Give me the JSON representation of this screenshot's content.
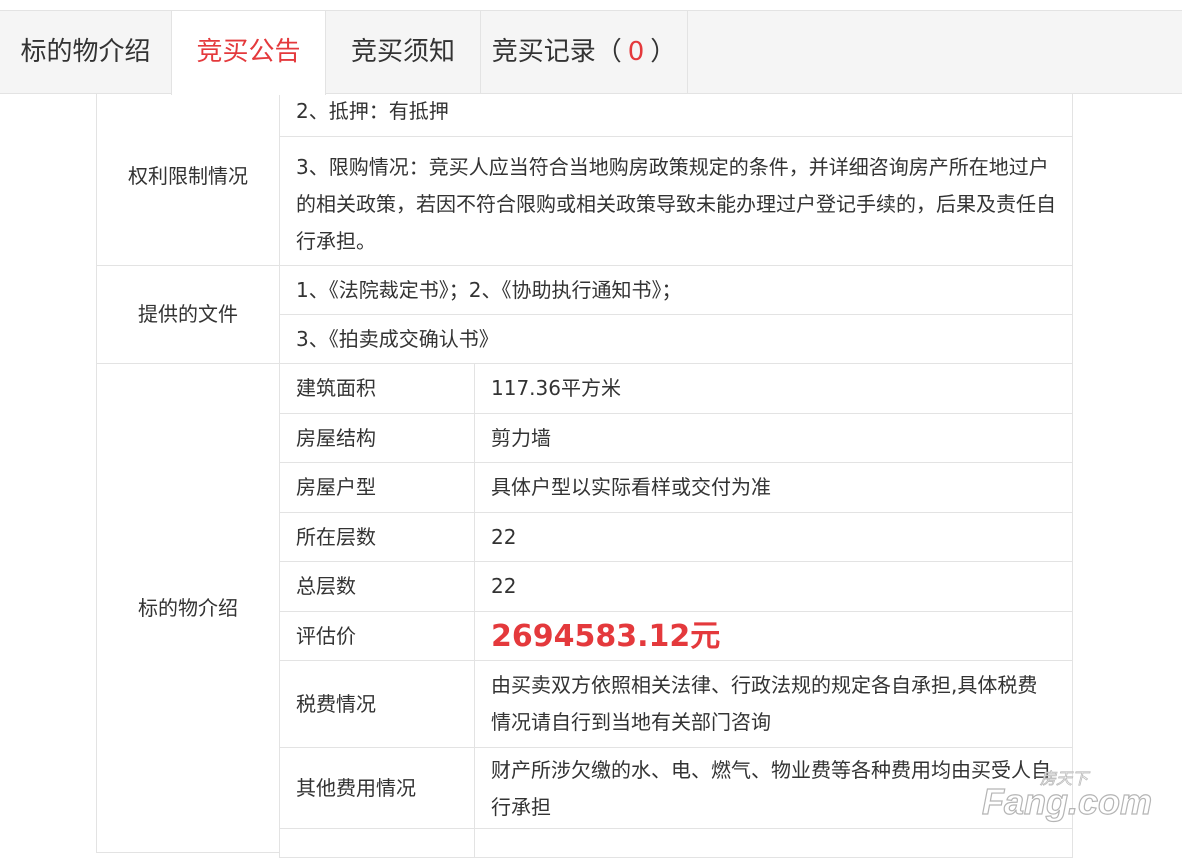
{
  "tabs": [
    {
      "label": "标的物介绍"
    },
    {
      "label": "竞买公告"
    },
    {
      "label": "竞买须知"
    },
    {
      "label": "竞买记录（",
      "count": "0",
      "suffix": "）"
    }
  ],
  "sections": {
    "rights": {
      "label": "权利限制情况",
      "item2": "2、抵押：有抵押",
      "item3": "3、限购情况：竞买人应当符合当地购房政策规定的条件，并详细咨询房产所在地过户的相关政策，若因不符合限购或相关政策导致未能办理过户登记手续的，后果及责任自行承担。"
    },
    "documents": {
      "label": "提供的文件",
      "item1": "1、《法院裁定书》；2、《协助执行通知书》；",
      "item2": "3、《拍卖成交确认书》"
    },
    "subject": {
      "label": "标的物介绍",
      "rows": [
        {
          "key": "建筑面积",
          "value": "117.36平方米"
        },
        {
          "key": "房屋结构",
          "value": "剪力墙"
        },
        {
          "key": "房屋户型",
          "value": "具体户型以实际看样或交付为准"
        },
        {
          "key": "所在层数",
          "value": "22"
        },
        {
          "key": "总层数",
          "value": "22"
        },
        {
          "key": "评估价",
          "value": "2694583.12元"
        },
        {
          "key": "税费情况",
          "value": "由买卖双方依照相关法律、行政法规的规定各自承担,具体税费情况请自行到当地有关部门咨询"
        },
        {
          "key": "其他费用情况",
          "value": "财产所涉欠缴的水、电、燃气、物业费等各种费用均由买受人自行承担"
        }
      ]
    }
  },
  "watermark": {
    "top": "房天下",
    "brand": "Fang.com"
  },
  "colors": {
    "accent": "#e4393c",
    "border": "#e3e3e3",
    "tabbar": "#f5f5f5"
  }
}
